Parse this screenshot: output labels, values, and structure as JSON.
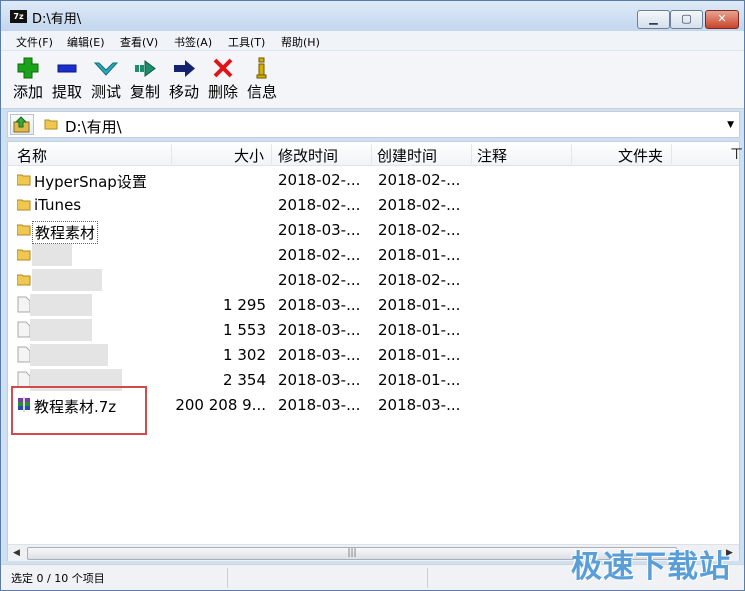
{
  "window": {
    "title": "D:\\有用\\",
    "app_icon_text": "7z"
  },
  "menu": [
    "文件(F)",
    "编辑(E)",
    "查看(V)",
    "书签(A)",
    "工具(T)",
    "帮助(H)"
  ],
  "toolbar": [
    {
      "label": "添加",
      "icon": "add-icon",
      "color": "#1aa31a"
    },
    {
      "label": "提取",
      "icon": "extract-icon",
      "color": "#1b2fd1"
    },
    {
      "label": "测试",
      "icon": "test-icon",
      "color": "#2aa7b8"
    },
    {
      "label": "复制",
      "icon": "copy-icon",
      "color": "#1a8f6a"
    },
    {
      "label": "移动",
      "icon": "move-icon",
      "color": "#15236d"
    },
    {
      "label": "删除",
      "icon": "delete-icon",
      "color": "#e01515"
    },
    {
      "label": "信息",
      "icon": "info-icon",
      "color": "#d4b000"
    }
  ],
  "address": {
    "path": "D:\\有用\\"
  },
  "columns": [
    "名称",
    "大小",
    "修改时间",
    "创建时间",
    "注释",
    "文件夹"
  ],
  "rows": [
    {
      "name": "HyperSnap设置",
      "size": "",
      "modified": "2018-02-...",
      "created": "2018-02-...",
      "type": "folder"
    },
    {
      "name": "iTunes",
      "size": "",
      "modified": "2018-02-...",
      "created": "2018-02-...",
      "type": "folder"
    },
    {
      "name": "教程素材",
      "size": "",
      "modified": "2018-03-...",
      "created": "2018-02-...",
      "type": "folder"
    },
    {
      "name": "",
      "size": "",
      "modified": "2018-02-...",
      "created": "2018-01-...",
      "type": "folder"
    },
    {
      "name": "",
      "size": "",
      "modified": "2018-02-...",
      "created": "2018-02-...",
      "type": "folder"
    },
    {
      "name": "",
      "size": "1 295",
      "modified": "2018-03-...",
      "created": "2018-01-...",
      "type": "file"
    },
    {
      "name": "",
      "size": "1 553",
      "modified": "2018-03-...",
      "created": "2018-01-...",
      "type": "file"
    },
    {
      "name": "",
      "size": "1 302",
      "modified": "2018-03-...",
      "created": "2018-01-...",
      "type": "file"
    },
    {
      "name": "",
      "size": "2 354",
      "modified": "2018-03-...",
      "created": "2018-01-...",
      "type": "file"
    },
    {
      "name": "教程素材.7z",
      "size": "200 208 9...",
      "modified": "2018-03-...",
      "created": "2018-03-...",
      "type": "archive"
    }
  ],
  "status": {
    "text": "选定 0 / 10 个项目"
  },
  "watermark": "极速下载站"
}
